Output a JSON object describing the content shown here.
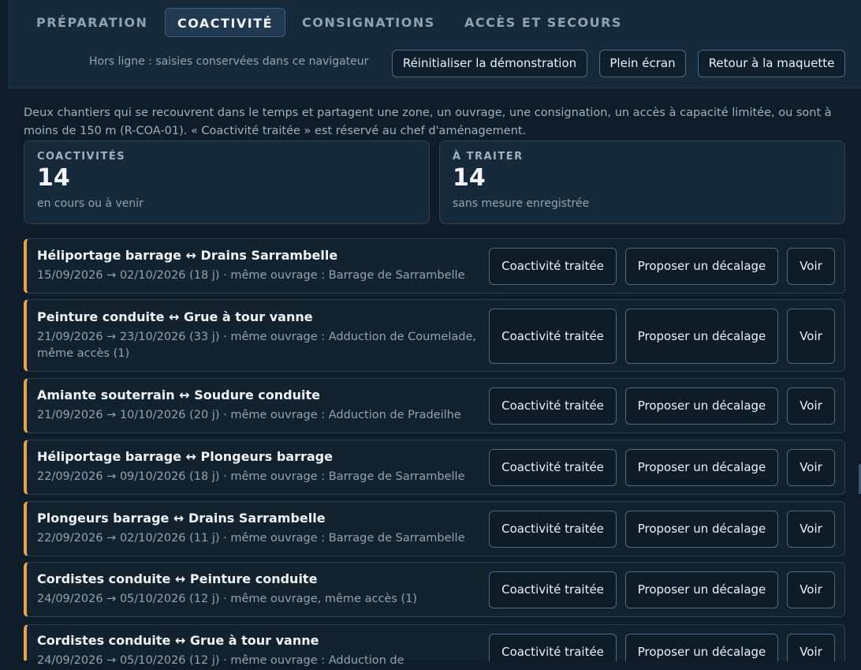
{
  "tabs": [
    {
      "label": "PRÉPARATION"
    },
    {
      "label": "COACTIVITÉ"
    },
    {
      "label": "CONSIGNATIONS"
    },
    {
      "label": "ACCÈS ET SECOURS"
    }
  ],
  "toolbar": {
    "offline_note": "Hors ligne : saisies conservées dans ce navigateur",
    "reset_label": "Réinitialiser la démonstration",
    "fullscreen_label": "Plein écran",
    "back_label": "Retour à la maquette"
  },
  "intro": "Deux chantiers qui se recouvrent dans le temps et partagent une zone, un ouvrage, une consignation, un accès à capacité limitée, ou sont à moins de 150 m (R-COA-01). « Coactivité traitée » est réservé au chef d'aménagement.",
  "stats": [
    {
      "label": "COACTIVITÉS",
      "value": "14",
      "sub": "en cours ou à venir"
    },
    {
      "label": "À TRAITER",
      "value": "14",
      "sub": "sans mesure enregistrée"
    }
  ],
  "actions": {
    "treated": "Coactivité traitée",
    "shift": "Proposer un décalage",
    "view": "Voir"
  },
  "coactivities": [
    {
      "title": "Héliportage barrage ↔ Drains Sarrambelle",
      "meta": "15/09/2026 → 02/10/2026 (18 j) · même ouvrage : Barrage de Sarrambelle"
    },
    {
      "title": "Peinture conduite ↔ Grue à tour vanne",
      "meta": "21/09/2026 → 23/10/2026 (33 j) · même ouvrage : Adduction de Coumelade, même accès (1)"
    },
    {
      "title": "Amiante souterrain ↔ Soudure conduite",
      "meta": "21/09/2026 → 10/10/2026 (20 j) · même ouvrage : Adduction de Pradeilhe"
    },
    {
      "title": "Héliportage barrage ↔ Plongeurs barrage",
      "meta": "22/09/2026 → 09/10/2026 (18 j) · même ouvrage : Barrage de Sarrambelle"
    },
    {
      "title": "Plongeurs barrage ↔ Drains Sarrambelle",
      "meta": "22/09/2026 → 02/10/2026 (11 j) · même ouvrage : Barrage de Sarrambelle"
    },
    {
      "title": "Cordistes conduite ↔ Peinture conduite",
      "meta": "24/09/2026 → 05/10/2026 (12 j) · même ouvrage, même accès (1)"
    },
    {
      "title": "Cordistes conduite ↔ Grue à tour vanne",
      "meta": "24/09/2026 → 05/10/2026 (12 j) · même ouvrage : Adduction de"
    }
  ]
}
